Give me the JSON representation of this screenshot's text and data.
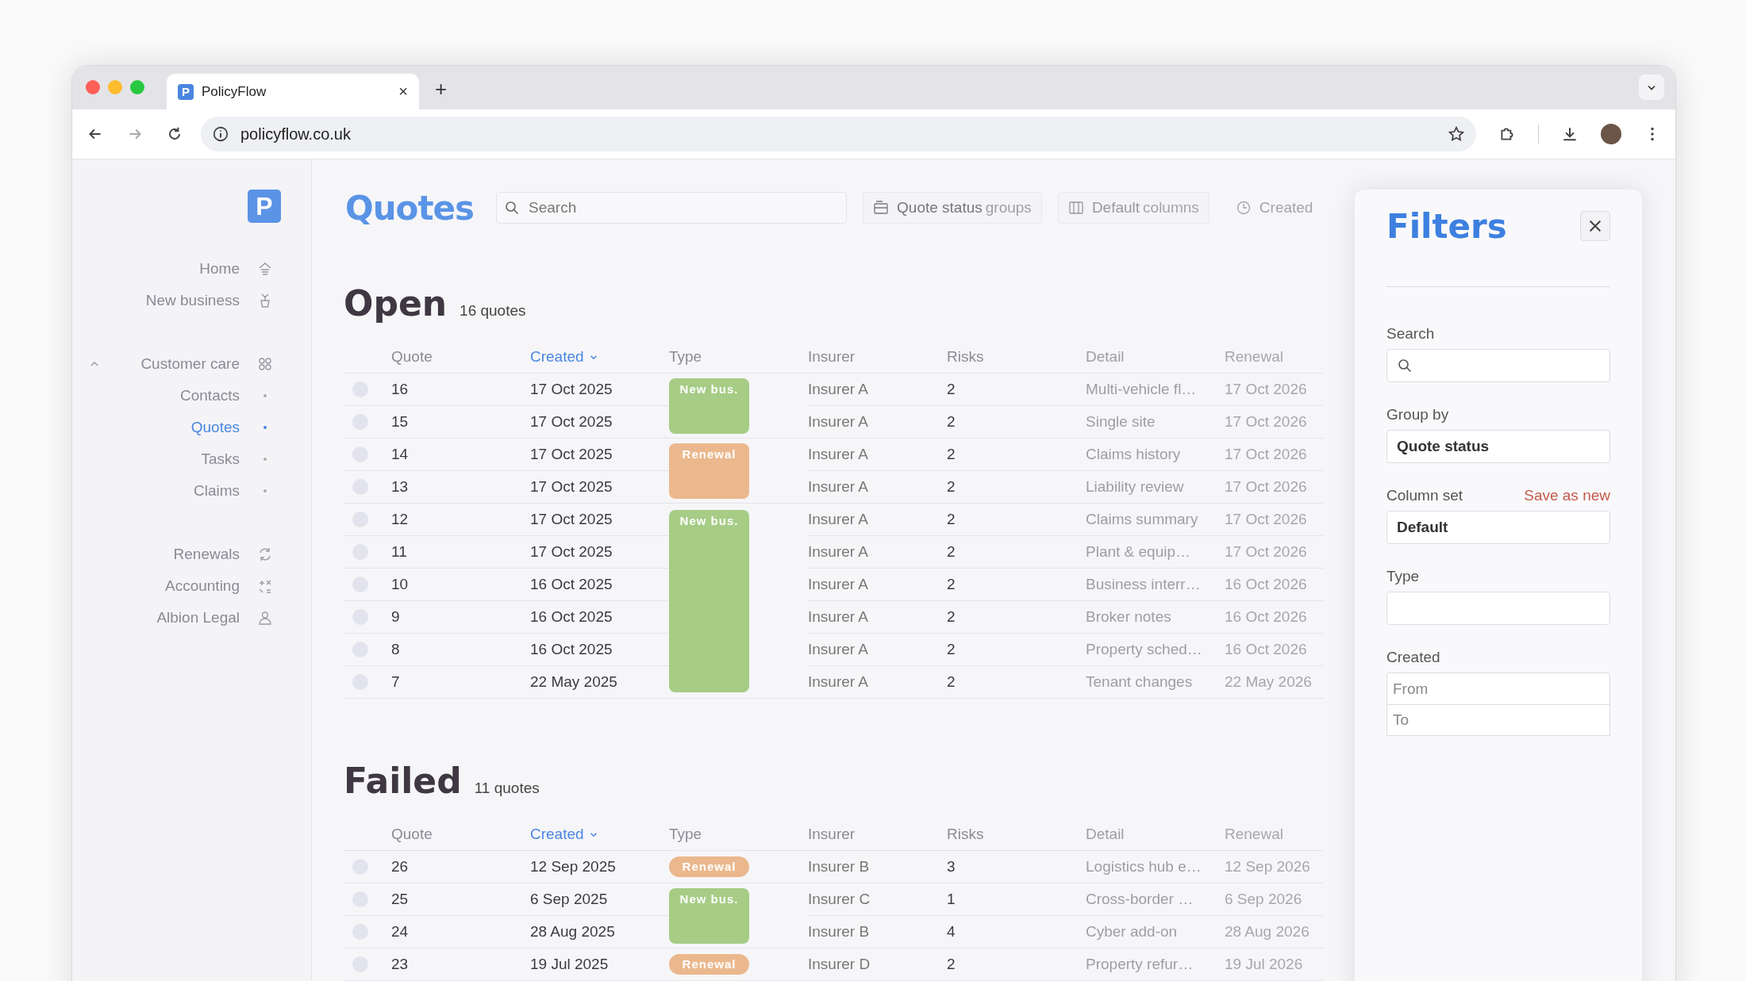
{
  "browser": {
    "tab": {
      "brand_mark": "P",
      "title": "PolicyFlow",
      "close": "×"
    },
    "new_tab": "+",
    "address": "policyflow.co.uk"
  },
  "sidebar": {
    "logo": "P",
    "groups": [
      {
        "items": [
          {
            "label": "Home",
            "selected": false
          },
          {
            "label": "New business",
            "selected": false
          }
        ]
      },
      {
        "items": [
          {
            "label": "Customer care",
            "selected": false,
            "expanded": true,
            "children": [
              {
                "label": "Contacts",
                "selected": false
              },
              {
                "label": "Quotes",
                "selected": true
              },
              {
                "label": "Tasks",
                "selected": false
              },
              {
                "label": "Claims",
                "selected": false
              }
            ]
          }
        ]
      },
      {
        "items": [
          {
            "label": "Renewals",
            "selected": false
          },
          {
            "label": "Accounting",
            "selected": false
          },
          {
            "label": "Albion Legal",
            "selected": false
          }
        ]
      }
    ]
  },
  "page": {
    "title": "Quotes",
    "search": {
      "placeholder": "Search"
    },
    "toolbar": [
      {
        "kind": "groups",
        "value": "Quote status",
        "suffix": "groups"
      },
      {
        "kind": "columns",
        "value": "Default",
        "suffix": "columns"
      },
      {
        "kind": "clock",
        "value": "Created"
      }
    ]
  },
  "sections": [
    {
      "title": "Open",
      "count": "16 quotes",
      "columns": [
        {
          "label": "Quote",
          "sorted": false
        },
        {
          "label": "Created",
          "sorted": true
        },
        {
          "label": "Type",
          "sorted": false
        },
        {
          "label": "Insurer",
          "sorted": false
        },
        {
          "label": "Risks",
          "sorted": false
        },
        {
          "label": "Detail",
          "sorted": false
        },
        {
          "label": "Renewal",
          "sorted": false
        }
      ],
      "groups": [
        {
          "kind": "new",
          "label": "New bus.",
          "rows": [
            {
              "quote": "16",
              "created": "17 Oct 2025",
              "insurer": "Insurer A",
              "risks": "2",
              "detail": "Multi-vehicle fl…",
              "renewal": "17 Oct 2026",
              "selected": false
            },
            {
              "quote": "15",
              "created": "17 Oct 2025",
              "insurer": "Insurer A",
              "risks": "2",
              "detail": "Single site",
              "renewal": "17 Oct 2026",
              "selected": false
            }
          ]
        },
        {
          "kind": "renewal",
          "label": "Renewal",
          "rows": [
            {
              "quote": "14",
              "created": "17 Oct 2025",
              "insurer": "Insurer A",
              "risks": "2",
              "detail": "Claims history",
              "renewal": "17 Oct 2026",
              "selected": false
            },
            {
              "quote": "13",
              "created": "17 Oct 2025",
              "insurer": "Insurer A",
              "risks": "2",
              "detail": "Liability review",
              "renewal": "17 Oct 2026",
              "selected": false
            }
          ]
        },
        {
          "kind": "new",
          "label": "New bus.",
          "rows": [
            {
              "quote": "12",
              "created": "17 Oct 2025",
              "insurer": "Insurer A",
              "risks": "2",
              "detail": "Claims summary",
              "renewal": "17 Oct 2026",
              "selected": false
            },
            {
              "quote": "11",
              "created": "17 Oct 2025",
              "insurer": "Insurer A",
              "risks": "2",
              "detail": "Plant & equip…",
              "renewal": "17 Oct 2026",
              "selected": false
            },
            {
              "quote": "10",
              "created": "16 Oct 2025",
              "insurer": "Insurer A",
              "risks": "2",
              "detail": "Business interr…",
              "renewal": "16 Oct 2026",
              "selected": false
            },
            {
              "quote": "9",
              "created": "16 Oct 2025",
              "insurer": "Insurer A",
              "risks": "2",
              "detail": "Broker notes",
              "renewal": "16 Oct 2026",
              "selected": false
            },
            {
              "quote": "8",
              "created": "16 Oct 2025",
              "insurer": "Insurer A",
              "risks": "2",
              "detail": "Property sched…",
              "renewal": "16 Oct 2026",
              "selected": false
            },
            {
              "quote": "7",
              "created": "22 May 2025",
              "insurer": "Insurer A",
              "risks": "2",
              "detail": "Tenant changes",
              "renewal": "22 May 2026",
              "selected": false
            }
          ]
        }
      ]
    },
    {
      "title": "Failed",
      "count": "11 quotes",
      "columns": [
        {
          "label": "Quote",
          "sorted": false
        },
        {
          "label": "Created",
          "sorted": true
        },
        {
          "label": "Type",
          "sorted": false
        },
        {
          "label": "Insurer",
          "sorted": false
        },
        {
          "label": "Risks",
          "sorted": false
        },
        {
          "label": "Detail",
          "sorted": false
        },
        {
          "label": "Renewal",
          "sorted": false
        }
      ],
      "groups": [
        {
          "kind": "renewal",
          "label": "Renewal",
          "rows": [
            {
              "quote": "26",
              "created": "12 Sep 2025",
              "insurer": "Insurer B",
              "risks": "3",
              "detail": "Logistics hub e…",
              "renewal": "12 Sep 2026",
              "selected": false
            }
          ]
        },
        {
          "kind": "new",
          "label": "New bus.",
          "rows": [
            {
              "quote": "25",
              "created": "6 Sep 2025",
              "insurer": "Insurer C",
              "risks": "1",
              "detail": "Cross-border …",
              "renewal": "6 Sep 2026",
              "selected": false
            },
            {
              "quote": "24",
              "created": "28 Aug 2025",
              "insurer": "Insurer B",
              "risks": "4",
              "detail": "Cyber add-on",
              "renewal": "28 Aug 2026",
              "selected": false
            }
          ]
        },
        {
          "kind": "renewal",
          "label": "Renewal",
          "rows": [
            {
              "quote": "23",
              "created": "19 Jul 2025",
              "insurer": "Insurer D",
              "risks": "2",
              "detail": "Property refur…",
              "renewal": "19 Jul 2026",
              "selected": false
            }
          ]
        }
      ]
    }
  ],
  "filters": {
    "title": "Filters",
    "search": {
      "label": "Search"
    },
    "group_by": {
      "label": "Group by",
      "value": "Quote status"
    },
    "column_set": {
      "label": "Column set",
      "action": "Save as new",
      "value": "Default"
    },
    "type": {
      "label": "Type"
    },
    "created": {
      "label": "Created",
      "from_placeholder": "From",
      "to_placeholder": "To"
    }
  }
}
